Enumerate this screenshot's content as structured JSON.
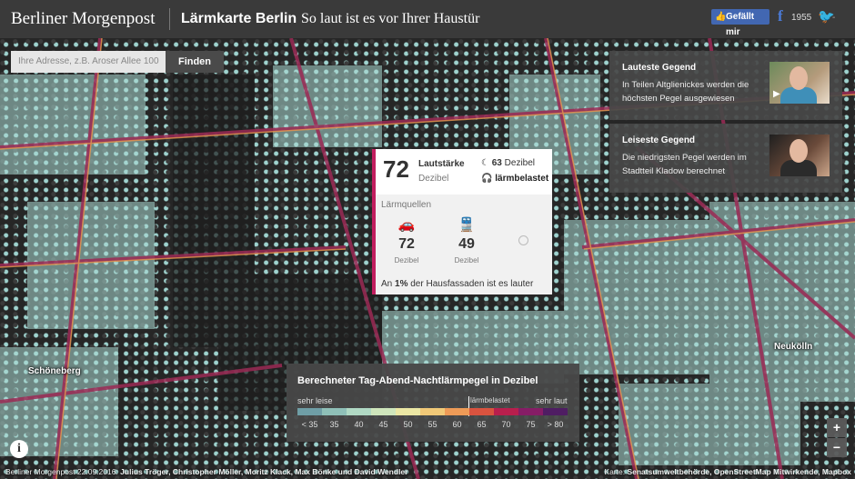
{
  "header": {
    "brand": "Berliner Morgenpost",
    "title": "Lärmkarte Berlin",
    "subtitle": "So laut ist es vor Ihrer Haustür",
    "fb_like_label": "Gefällt mir",
    "fb_count": "1955",
    "tw_count": "-"
  },
  "search": {
    "placeholder": "Ihre Adresse, z.B. Aroser Allee 100",
    "button_label": "Finden"
  },
  "popup": {
    "db_value": "72",
    "laut_label": "Lautstärke",
    "laut_unit": "Dezibel",
    "night_value": "63",
    "night_unit": "Dezibel",
    "status": "lärmbelastet",
    "sources_title": "Lärmquellen",
    "car_value": "72",
    "car_unit": "Dezibel",
    "train_value": "49",
    "train_unit": "Dezibel",
    "footer_pre": "An ",
    "footer_bold": "1%",
    "footer_post": " der Hausfassaden ist es lauter"
  },
  "cards": [
    {
      "title": "Lauteste Gegend",
      "text": "In Teilen Altglienickes werden die höchsten Pegel ausgewiesen"
    },
    {
      "title": "Leiseste Gegend",
      "text": "Die niedrigsten Pegel werden im Stadtteil Kladow berechnet"
    }
  ],
  "legend": {
    "title": "Berechneter Tag-Abend-Nachtlärmpegel in Dezibel",
    "low_label": "sehr leise",
    "threshold_label": "lärmbelastet",
    "high_label": "sehr laut",
    "ticks": [
      "< 35",
      "35",
      "40",
      "45",
      "50",
      "55",
      "60",
      "65",
      "70",
      "75",
      "> 80"
    ],
    "colors": [
      "#6f9ea6",
      "#8fc0b8",
      "#b0d9c4",
      "#cfe6bc",
      "#ebe7a4",
      "#f1c978",
      "#ee9b57",
      "#d9533f",
      "#b81f4d",
      "#861d66",
      "#4f1d63"
    ]
  },
  "places": {
    "schoeneberg": "Schöneberg",
    "neukoelln": "Neukölln"
  },
  "controls": {
    "info": "i",
    "zoom_in": "+",
    "zoom_out": "−"
  },
  "credits": {
    "left_pre": "Berliner Morgenpost 22.09.2016: ",
    "left_names": "Julius Tröger, Christopher Möller, Moritz Klack, Max Bönke und David Wendler",
    "right_pre": "Karte: ",
    "right_names": "Senatsumweltbehörde, OpenStreetMap Mitwirkende, Mapbox"
  }
}
